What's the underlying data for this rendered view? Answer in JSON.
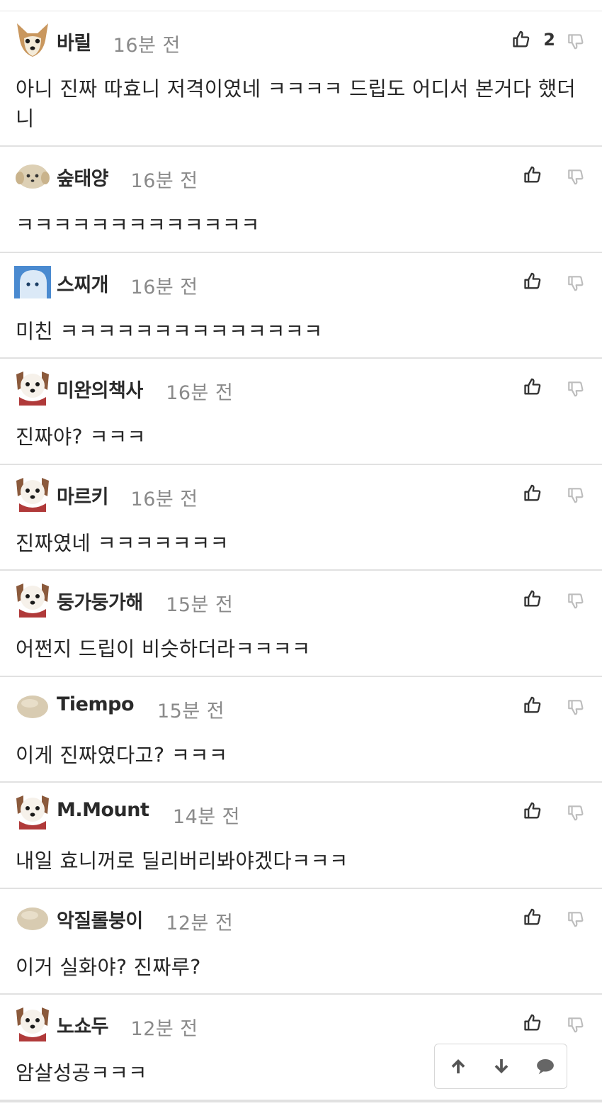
{
  "comments": [
    {
      "nickname": "바릴",
      "time": "16분 전",
      "likes": "2",
      "avatar": "chihuahua-avatar",
      "text": "아니 진짜 따효니 저격이였네 ㅋㅋㅋㅋ 드립도 어디서 본거다 했더니"
    },
    {
      "nickname": "숲태양",
      "time": "16분 전",
      "likes": "",
      "avatar": "puppy-avatar",
      "text": "ㅋㅋㅋㅋㅋㅋㅋㅋㅋㅋㅋㅋㅋ"
    },
    {
      "nickname": "스찌개",
      "time": "16분 전",
      "likes": "",
      "avatar": "blue-ghost-avatar",
      "text": "미친 ㅋㅋㅋㅋㅋㅋㅋㅋㅋㅋㅋㅋㅋㅋ"
    },
    {
      "nickname": "미완의책사",
      "time": "16분 전",
      "likes": "",
      "avatar": "dog-scarf-avatar",
      "text": "진짜야? ㅋㅋㅋ"
    },
    {
      "nickname": "마르키",
      "time": "16분 전",
      "likes": "",
      "avatar": "dog-scarf-avatar",
      "text": "진짜였네 ㅋㅋㅋㅋㅋㅋㅋ"
    },
    {
      "nickname": "둥가둥가해",
      "time": "15분 전",
      "likes": "",
      "avatar": "dog-scarf-avatar",
      "text": "어쩐지 드립이 비슷하더라ㅋㅋㅋㅋ"
    },
    {
      "nickname": "Tiempo",
      "time": "15분 전",
      "likes": "",
      "avatar": "blob-avatar",
      "text": "이게 진짜였다고? ㅋㅋㅋ"
    },
    {
      "nickname": "M.Mount",
      "time": "14분 전",
      "likes": "",
      "avatar": "dog-scarf-avatar",
      "text": "내일 효니꺼로 딜리버리봐야겠다ㅋㅋㅋ"
    },
    {
      "nickname": "악질롤붕이",
      "time": "12분 전",
      "likes": "",
      "avatar": "blob-avatar",
      "text": "이거 실화야? 진짜루?"
    },
    {
      "nickname": "노쇼두",
      "time": "12분 전",
      "likes": "",
      "avatar": "dog-scarf-avatar",
      "text": "암살성공ㅋㅋㅋ"
    }
  ],
  "icons": {
    "like": "thumbs-up-icon",
    "dislike": "thumbs-down-icon",
    "scroll_up": "arrow-up-icon",
    "scroll_down": "arrow-down-icon",
    "comment": "comment-bubble-icon"
  },
  "colors": {
    "divider": "#e1e1e1",
    "time": "#8a8a8a",
    "icon": "#333333",
    "dislike_icon": "#bdbdbd"
  }
}
